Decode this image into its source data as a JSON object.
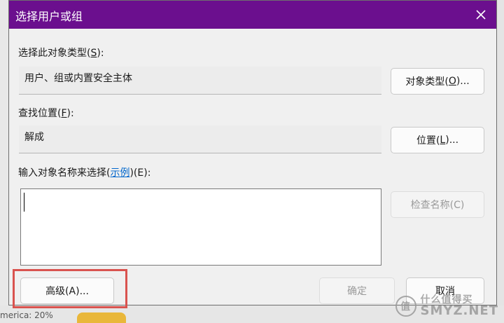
{
  "background": {
    "fragment_text": "merica: 20%"
  },
  "dialog": {
    "title": "选择用户或组",
    "object_type_label": "选择此对象类型(",
    "object_type_key": "S",
    "object_type_label_end": "):",
    "object_type_value": "用户、组或内置安全主体",
    "object_type_button": {
      "text": "对象类型(",
      "key": "O",
      "end": ")..."
    },
    "location_label": "查找位置(",
    "location_key": "F",
    "location_label_end": "):",
    "location_value": "解成",
    "location_button": {
      "text": "位置(",
      "key": "L",
      "end": ")..."
    },
    "names_label": "输入对象名称来选择(",
    "names_link": "示例",
    "names_label_end": ")(E):",
    "names_value": "",
    "check_names_button": "检查名称(C)",
    "advanced_button": "高级(A)...",
    "ok_button": "确定",
    "cancel_button": "取消"
  },
  "watermark": {
    "glyph": "值",
    "text": "什么值得买",
    "site": "SMYZ.NET"
  },
  "colors": {
    "titlebar": "#6b0f8e",
    "highlight": "#d9534f",
    "link": "#0066cc"
  }
}
